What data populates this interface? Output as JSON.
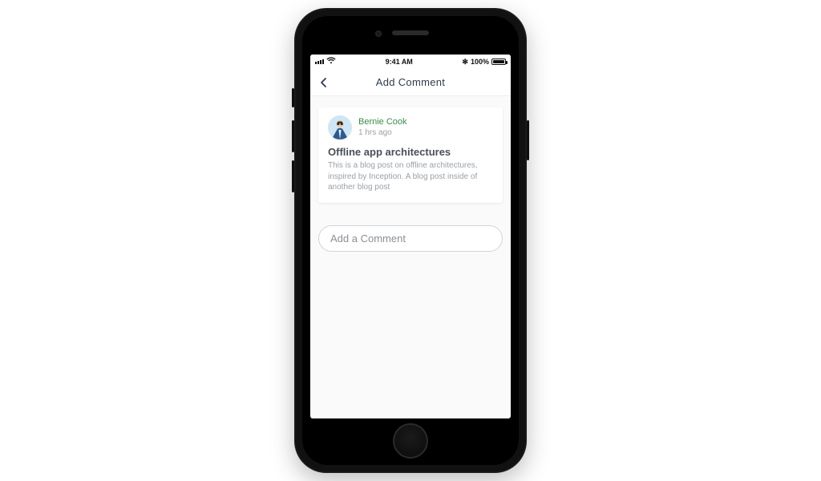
{
  "status_bar": {
    "time": "9:41 AM",
    "battery_pct": "100%",
    "bluetooth_glyph": "✻"
  },
  "nav": {
    "title": "Add Comment"
  },
  "post": {
    "author": "Bernie Cook",
    "time_ago": "1 hrs ago",
    "title": "Offline app architectures",
    "body": "This is a blog post on offline architectures, inspired by Inception. A blog post inside of another blog post"
  },
  "comment_input": {
    "placeholder": "Add a Comment"
  }
}
